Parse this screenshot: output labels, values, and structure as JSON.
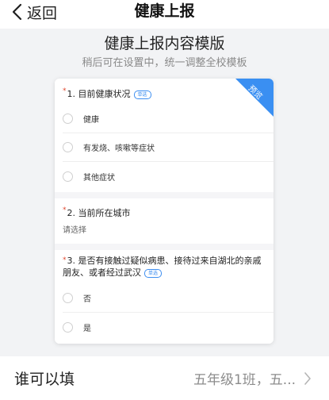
{
  "nav": {
    "back_label": "返回",
    "title": "健康上报"
  },
  "template": {
    "title": "健康上报内容模版",
    "subtitle": "稍后可在设置中，统一调整全校模板"
  },
  "card": {
    "ribbon": "预览",
    "q1": {
      "required_mark": "*",
      "title": "1. 目前健康状况",
      "tag": "单选",
      "options": [
        "健康",
        "有发烧、咳嗽等症状",
        "其他症状"
      ]
    },
    "q2": {
      "required_mark": "*",
      "title": "2. 当前所在城市",
      "placeholder": "请选择"
    },
    "q3": {
      "required_mark": "*",
      "title_line1": "3. 是否有接触过疑似病患、接待过来自湖北的亲戚",
      "title_line2": "朋友、或者经过武汉",
      "tag": "单选",
      "options": [
        "否",
        "是"
      ]
    }
  },
  "fill_scope": {
    "label": "谁可以填",
    "value": "五年级1班，五..."
  },
  "colors": {
    "accent": "#3a8ff2",
    "required": "#e0452b",
    "background": "#f2f3f5"
  }
}
